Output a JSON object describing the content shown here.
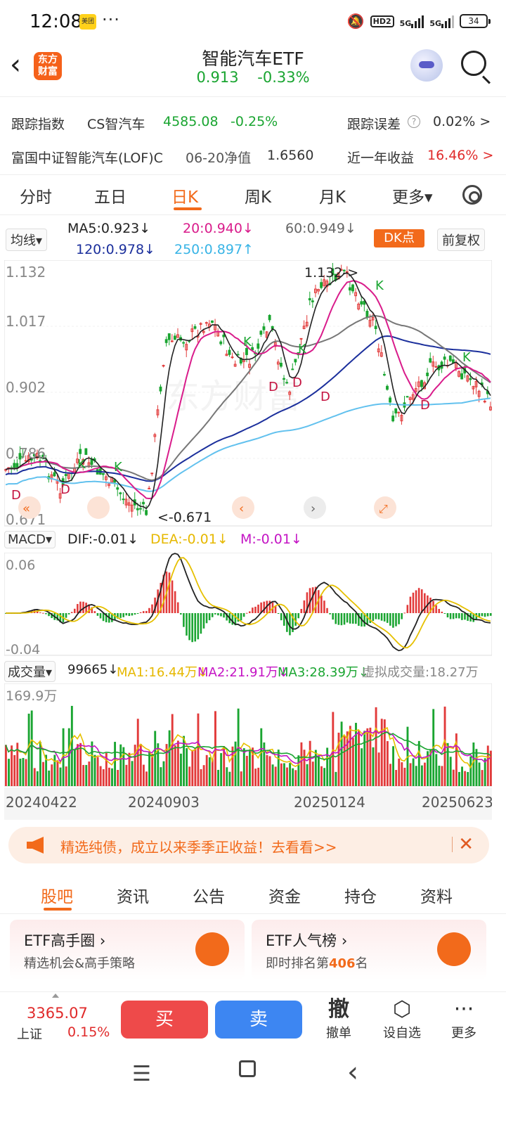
{
  "status": {
    "time": "12:08",
    "app_badge": "美团",
    "dots": "···",
    "hd": "HD2",
    "net1": "5G",
    "net2": "5G",
    "battery": "34"
  },
  "header": {
    "back_icon": "chevron-left-icon",
    "logo_text": "东方财富",
    "title": "智能汽车ETF",
    "price": "0.913",
    "change_pct": "-0.33%"
  },
  "tracking": {
    "label": "跟踪指数",
    "index_name": "CS智汽车",
    "index_value": "4585.08",
    "index_pct": "-0.25%",
    "err_label": "跟踪误差",
    "err_value": "0.02% >"
  },
  "fund": {
    "name": "富国中证智能汽车(LOF)C",
    "nav_label": "06-20净值",
    "nav_value": "1.6560",
    "ret_label": "近一年收益",
    "ret_value": "16.46% >"
  },
  "period_tabs": [
    "分时",
    "五日",
    "日K",
    "周K",
    "月K",
    "更多▾"
  ],
  "active_period": "日K",
  "ma": {
    "selector": "均线▾",
    "ma5": "MA5:0.923↓",
    "ma20": "20:0.940↓",
    "ma60": "60:0.949↓",
    "ma120": "120:0.978↓",
    "ma250": "250:0.897↑",
    "dk": "DK点",
    "adjust": "前复权"
  },
  "kchart": {
    "y_labels": [
      "1.132",
      "1.017",
      "0.902",
      "0.786",
      "0.671"
    ],
    "max_label": "1.132->",
    "min_label": "<-0.671",
    "markers": [
      "D",
      "D",
      "K",
      "K",
      "K",
      "D",
      "D",
      "K",
      "D",
      "K",
      "K",
      "D"
    ],
    "watermark": "东方财富"
  },
  "macd": {
    "selector": "MACD▾",
    "dif": "DIF:-0.01↓",
    "dea": "DEA:-0.01↓",
    "m": "M:-0.01↓",
    "top": "0.06",
    "bottom": "-0.04"
  },
  "volume": {
    "selector": "成交量▾",
    "vol": "99665↓",
    "ma1": "MA1:16.44万↓",
    "ma2": "MA2:21.91万↓",
    "ma3": "MA3:28.39万↓",
    "virtual": "虚拟成交量:18.27万",
    "top": "169.9万",
    "dates": [
      "20240422",
      "20240903",
      "20250124",
      "20250623"
    ]
  },
  "banner": {
    "icon": "megaphone-icon",
    "text": "精选纯债，成立以来季季正收益！去看看>>",
    "close": "✕"
  },
  "sub_tabs": [
    "股吧",
    "资讯",
    "公告",
    "资金",
    "持仓",
    "资料"
  ],
  "cards": [
    {
      "title": "ETF高手圈 ›",
      "subtitle": "精选机会&高手策略"
    },
    {
      "title": "ETF人气榜 ›",
      "subtitle_pre": "即时排名第",
      "rank": "406",
      "subtitle_post": "名"
    }
  ],
  "bottom": {
    "index_value": "3365.07",
    "index_name": "上证",
    "index_pct": "0.15%",
    "buy": "买",
    "sell": "卖",
    "cancel_icon": "撤",
    "cancel": "撤单",
    "watch": "设自选",
    "more": "更多"
  },
  "colors": {
    "accent": "#f26a1b",
    "up": "#e02a2a",
    "down": "#1aa531"
  }
}
